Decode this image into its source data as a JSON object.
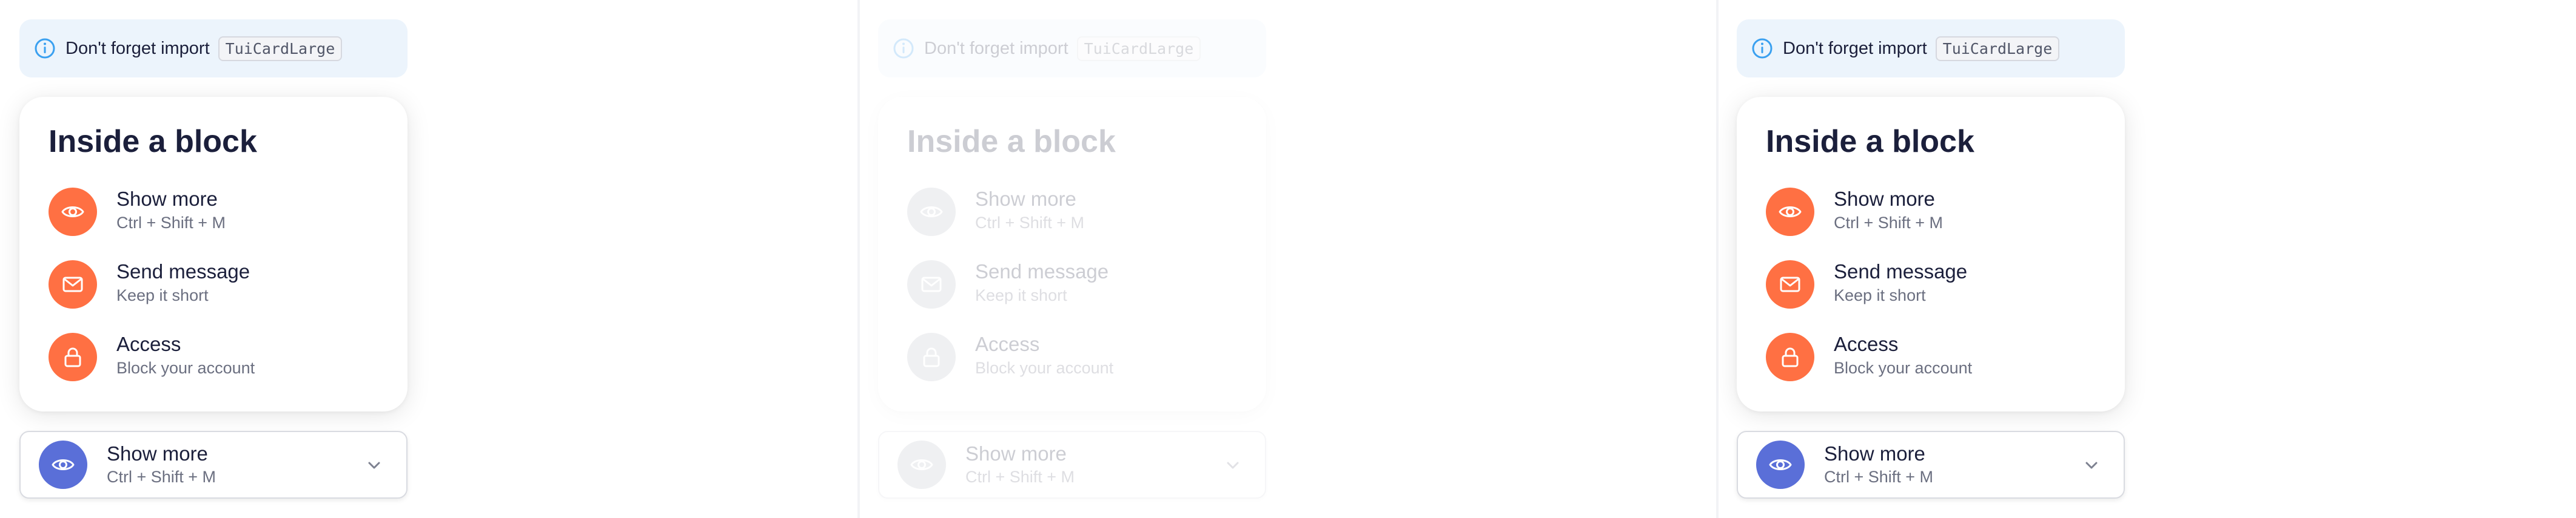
{
  "notice": {
    "text": "Don't forget import",
    "code": "TuiCardLarge"
  },
  "card": {
    "title": "Inside a block",
    "items": [
      {
        "title": "Show more",
        "subtitle": "Ctrl + Shift + M",
        "icon": "eye-icon"
      },
      {
        "title": "Send message",
        "subtitle": "Keep it short",
        "icon": "mail-icon"
      },
      {
        "title": "Access",
        "subtitle": "Block your account",
        "icon": "lock-icon"
      }
    ]
  },
  "dropdown": {
    "title": "Show more",
    "subtitle": "Ctrl + Shift + M",
    "icon": "eye-icon"
  },
  "colors": {
    "accent_orange": "#ff7043",
    "accent_blue": "#5a6fd8",
    "notice_bg": "#ecf4fc",
    "info_blue": "#3aa0f0"
  }
}
